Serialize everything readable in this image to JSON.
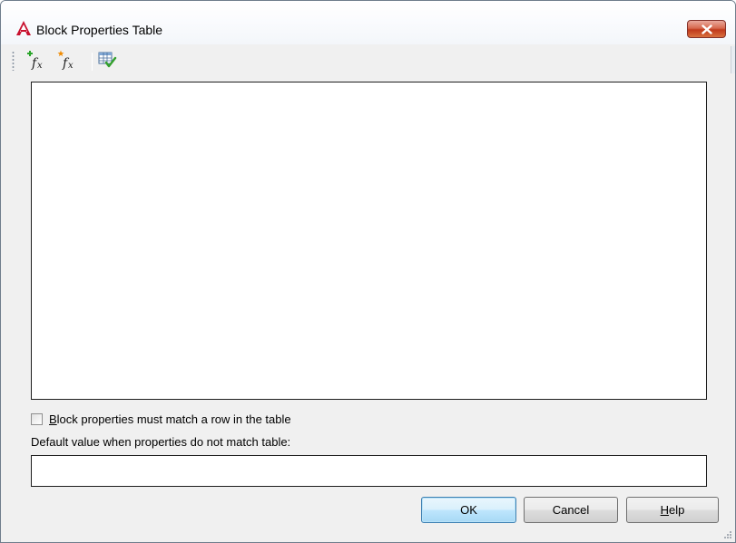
{
  "window": {
    "title": "Block Properties Table",
    "app_icon": "autocad-logo-icon"
  },
  "titlebar": {
    "close_icon": "close-icon"
  },
  "toolbar": {
    "buttons": [
      {
        "icon": "new-property-parameter-icon"
      },
      {
        "icon": "add-user-parameter-icon"
      },
      {
        "icon": "audit-table-icon"
      }
    ]
  },
  "options": {
    "match_row_prefix": "B",
    "match_row_rest": "lock properties must match a row in the table",
    "match_row_checked": false
  },
  "default_value": {
    "label": "Default value when properties do not match table:",
    "value": ""
  },
  "buttons": {
    "ok": "OK",
    "cancel": "Cancel",
    "help_prefix": "H",
    "help_rest": "elp"
  },
  "colors": {
    "close_button": "#c0391b",
    "default_button_border": "#3c7fb1",
    "icon_plus_green": "#2aa52a",
    "icon_star_orange": "#f08a00",
    "icon_check_green": "#33a02c"
  }
}
